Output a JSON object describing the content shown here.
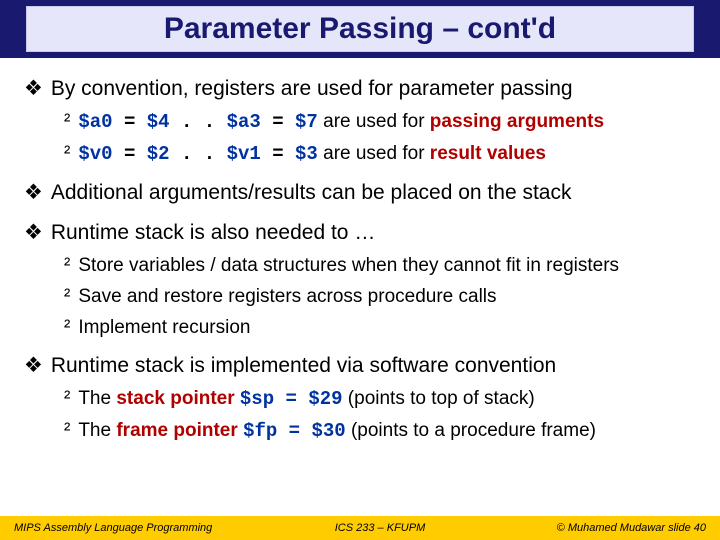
{
  "title": "Parameter Passing – cont'd",
  "b1": "By convention, registers are used for parameter passing",
  "s1a_r1": "$a0",
  "s1a_eq1": " = ",
  "s1a_r2": "$4",
  "s1a_dots": " . . ",
  "s1a_r3": "$a3",
  "s1a_eq2": " = ",
  "s1a_r4": "$7",
  "s1a_txt": " are used for ",
  "s1a_b": "passing arguments",
  "s1b_r1": "$v0",
  "s1b_eq1": " = ",
  "s1b_r2": "$2",
  "s1b_dots": " . . ",
  "s1b_r3": "$v1",
  "s1b_eq2": " = ",
  "s1b_r4": "$3",
  "s1b_txt": " are used for ",
  "s1b_b": "result values",
  "b2": "Additional arguments/results can be placed on the stack",
  "b3": "Runtime stack is also needed to …",
  "s3a": "Store variables / data structures when they cannot fit in registers",
  "s3b": "Save and restore registers across procedure calls",
  "s3c": "Implement recursion",
  "b4": "Runtime stack is implemented via software convention",
  "s4a_pre": "The ",
  "s4a_b": "stack pointer ",
  "s4a_reg": "$sp = $29",
  "s4a_post": " (points to top of stack)",
  "s4b_pre": "The ",
  "s4b_b": "frame pointer ",
  "s4b_reg": "$fp = $30",
  "s4b_post": " (points to a procedure frame)",
  "footer_left": "MIPS Assembly Language Programming",
  "footer_center": "ICS 233 – KFUPM",
  "footer_right": "© Muhamed Mudawar   slide 40"
}
